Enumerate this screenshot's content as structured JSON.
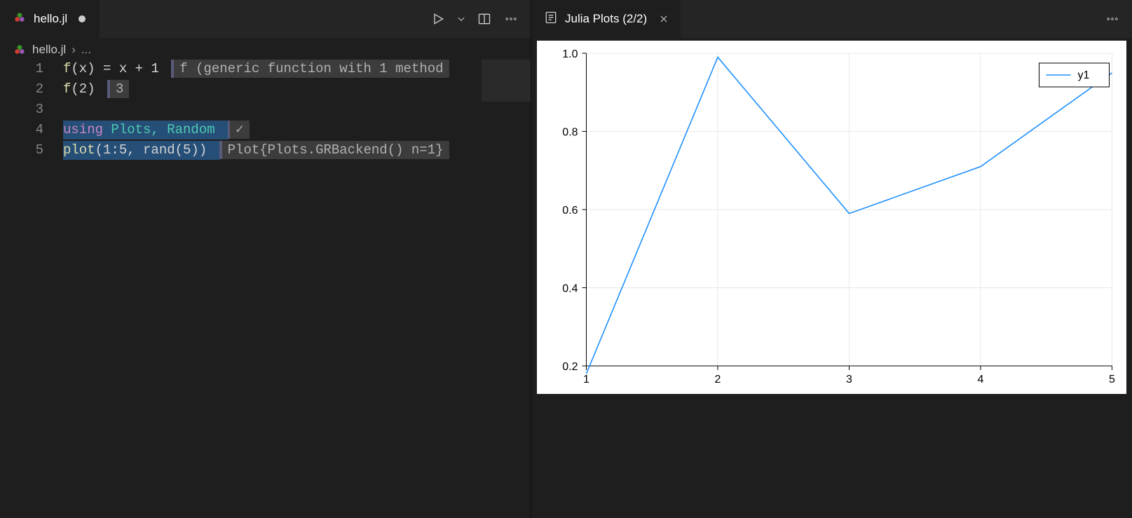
{
  "left_tab": {
    "filename": "hello.jl",
    "dirty": true
  },
  "right_tab": {
    "title": "Julia Plots (2/2)"
  },
  "breadcrumb": {
    "file": "hello.jl",
    "sep": "›",
    "tail": "..."
  },
  "gutter_numbers": [
    "1",
    "2",
    "3",
    "4",
    "5"
  ],
  "code": {
    "l1": {
      "fn": "f",
      "args": "(x)",
      "eq": " = ",
      "body": "x + 1"
    },
    "l2": {
      "fn": "f",
      "call": "(2)"
    },
    "l4_using": "using",
    "l4_mods": " Plots, Random",
    "l5_fn": "plot",
    "l5_args": "(1:5, rand(5))"
  },
  "inline_results": {
    "l1": "f (generic function with 1 method",
    "l2": "3",
    "l4": "✓",
    "l5": "Plot{Plots.GRBackend() n=1}"
  },
  "chart_data": {
    "type": "line",
    "title": "",
    "xlabel": "",
    "ylabel": "",
    "x": [
      1,
      2,
      3,
      4,
      5
    ],
    "series": [
      {
        "name": "y1",
        "values": [
          0.18,
          0.99,
          0.59,
          0.71,
          0.95
        ]
      }
    ],
    "xlim": [
      1,
      5
    ],
    "ylim": [
      0.2,
      1.0
    ],
    "xticks": [
      1,
      2,
      3,
      4,
      5
    ],
    "yticks": [
      0.2,
      0.4,
      0.6,
      0.8,
      1.0
    ],
    "legend": {
      "position": "topright",
      "entries": [
        "y1"
      ]
    },
    "color": "#1e90ff"
  }
}
